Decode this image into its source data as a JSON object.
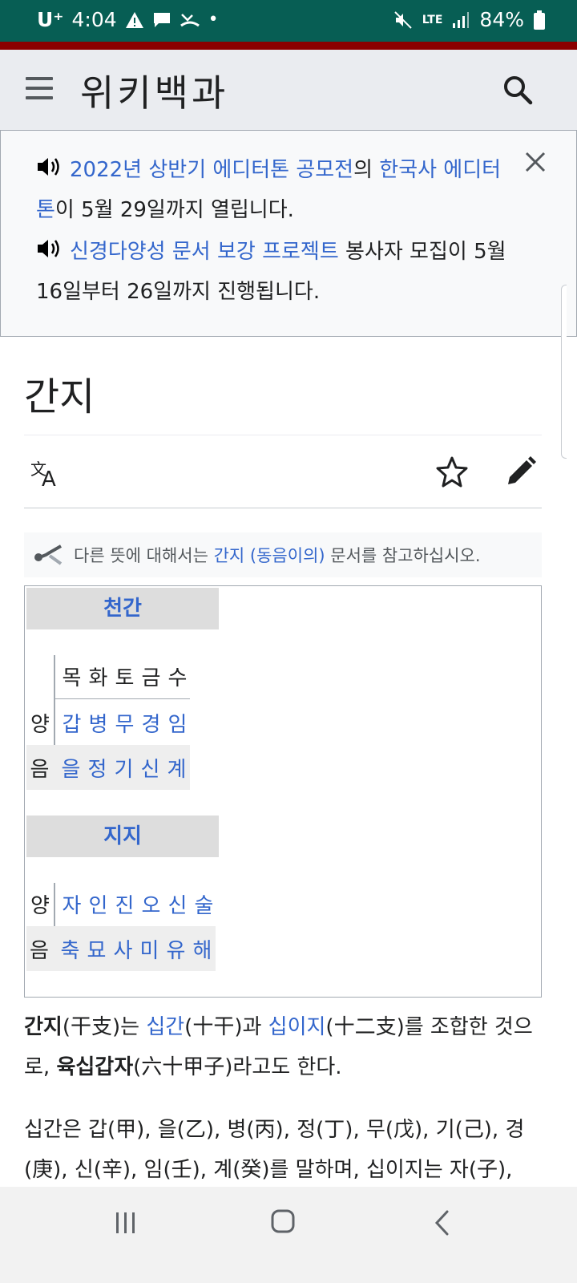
{
  "status_bar": {
    "carrier": "U⁺",
    "time": "4:04",
    "battery": "84%",
    "network": "LTE"
  },
  "header": {
    "site_title": "위키백과"
  },
  "banner": {
    "line1": {
      "link1": "2022년 상반기 에디터톤 공모전",
      "text1": "의 ",
      "link2": "한국사 에디터톤",
      "text2": "이 5월 29일까지 열립니다."
    },
    "line2": {
      "link1": "신경다양성 문서 보강 프로젝트",
      "text1": " 봉사자 모집이 5월 16일부터 26일까지 진행됩니다."
    }
  },
  "page": {
    "title": "간지"
  },
  "hatnote": {
    "prefix": "다른 뜻에 대해서는 ",
    "link": "간지 (동음이의)",
    "suffix": " 문서를 참고하십시오."
  },
  "infobox": {
    "cheongan": {
      "heading": "천간",
      "columns": [
        "목",
        "화",
        "토",
        "금",
        "수"
      ],
      "yang_label": "양",
      "yang": [
        "갑",
        "병",
        "무",
        "경",
        "임"
      ],
      "eum_label": "음",
      "eum": [
        "을",
        "정",
        "기",
        "신",
        "계"
      ]
    },
    "jiji": {
      "heading": "지지",
      "yang_label": "양",
      "yang": [
        "자",
        "인",
        "진",
        "오",
        "신",
        "술"
      ],
      "eum_label": "음",
      "eum": [
        "축",
        "묘",
        "사",
        "미",
        "유",
        "해"
      ]
    }
  },
  "article": {
    "p1": {
      "bold1": "간지",
      "t1": "(干支)는 ",
      "link1": "십간",
      "t2": "(十干)과 ",
      "link2": "십이지",
      "t3": "(十二支)를 조합한 것으로, ",
      "bold2": "육십갑자",
      "t4": "(六十甲子)라고도 한다."
    },
    "p2": "십간은 갑(甲), 을(乙), 병(丙), 정(丁), 무(戊), 기(己), 경(庚), 신(辛), 임(壬), 계(癸)를 말하며, 십이지는 자(子),"
  },
  "colors": {
    "status_bar": "#075e54",
    "header_bg": "#eaecf0",
    "link": "#3366cc",
    "infobox_head_bg": "#dddddd"
  }
}
